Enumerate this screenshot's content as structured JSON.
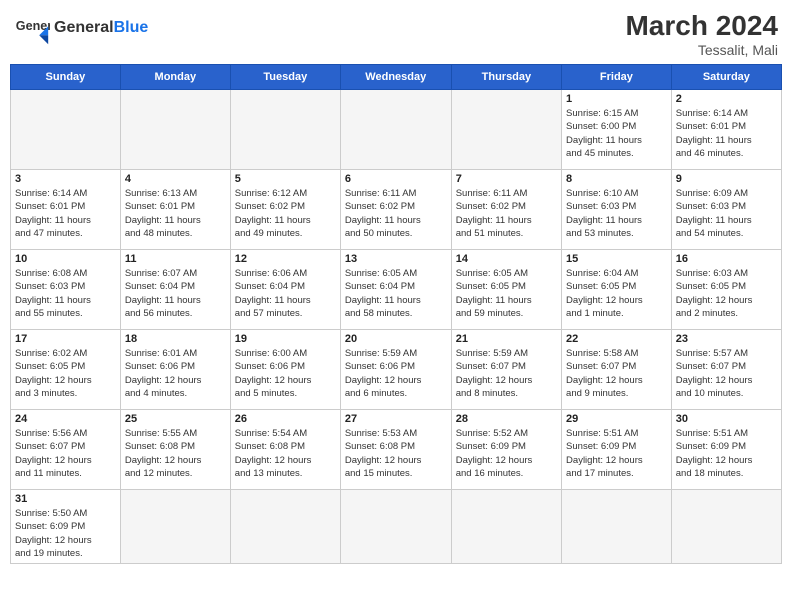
{
  "header": {
    "logo_general": "General",
    "logo_blue": "Blue",
    "month_year": "March 2024",
    "location": "Tessalit, Mali"
  },
  "weekdays": [
    "Sunday",
    "Monday",
    "Tuesday",
    "Wednesday",
    "Thursday",
    "Friday",
    "Saturday"
  ],
  "weeks": [
    [
      {
        "day": "",
        "info": ""
      },
      {
        "day": "",
        "info": ""
      },
      {
        "day": "",
        "info": ""
      },
      {
        "day": "",
        "info": ""
      },
      {
        "day": "",
        "info": ""
      },
      {
        "day": "1",
        "info": "Sunrise: 6:15 AM\nSunset: 6:00 PM\nDaylight: 11 hours\nand 45 minutes."
      },
      {
        "day": "2",
        "info": "Sunrise: 6:14 AM\nSunset: 6:01 PM\nDaylight: 11 hours\nand 46 minutes."
      }
    ],
    [
      {
        "day": "3",
        "info": "Sunrise: 6:14 AM\nSunset: 6:01 PM\nDaylight: 11 hours\nand 47 minutes."
      },
      {
        "day": "4",
        "info": "Sunrise: 6:13 AM\nSunset: 6:01 PM\nDaylight: 11 hours\nand 48 minutes."
      },
      {
        "day": "5",
        "info": "Sunrise: 6:12 AM\nSunset: 6:02 PM\nDaylight: 11 hours\nand 49 minutes."
      },
      {
        "day": "6",
        "info": "Sunrise: 6:11 AM\nSunset: 6:02 PM\nDaylight: 11 hours\nand 50 minutes."
      },
      {
        "day": "7",
        "info": "Sunrise: 6:11 AM\nSunset: 6:02 PM\nDaylight: 11 hours\nand 51 minutes."
      },
      {
        "day": "8",
        "info": "Sunrise: 6:10 AM\nSunset: 6:03 PM\nDaylight: 11 hours\nand 53 minutes."
      },
      {
        "day": "9",
        "info": "Sunrise: 6:09 AM\nSunset: 6:03 PM\nDaylight: 11 hours\nand 54 minutes."
      }
    ],
    [
      {
        "day": "10",
        "info": "Sunrise: 6:08 AM\nSunset: 6:03 PM\nDaylight: 11 hours\nand 55 minutes."
      },
      {
        "day": "11",
        "info": "Sunrise: 6:07 AM\nSunset: 6:04 PM\nDaylight: 11 hours\nand 56 minutes."
      },
      {
        "day": "12",
        "info": "Sunrise: 6:06 AM\nSunset: 6:04 PM\nDaylight: 11 hours\nand 57 minutes."
      },
      {
        "day": "13",
        "info": "Sunrise: 6:05 AM\nSunset: 6:04 PM\nDaylight: 11 hours\nand 58 minutes."
      },
      {
        "day": "14",
        "info": "Sunrise: 6:05 AM\nSunset: 6:05 PM\nDaylight: 11 hours\nand 59 minutes."
      },
      {
        "day": "15",
        "info": "Sunrise: 6:04 AM\nSunset: 6:05 PM\nDaylight: 12 hours\nand 1 minute."
      },
      {
        "day": "16",
        "info": "Sunrise: 6:03 AM\nSunset: 6:05 PM\nDaylight: 12 hours\nand 2 minutes."
      }
    ],
    [
      {
        "day": "17",
        "info": "Sunrise: 6:02 AM\nSunset: 6:05 PM\nDaylight: 12 hours\nand 3 minutes."
      },
      {
        "day": "18",
        "info": "Sunrise: 6:01 AM\nSunset: 6:06 PM\nDaylight: 12 hours\nand 4 minutes."
      },
      {
        "day": "19",
        "info": "Sunrise: 6:00 AM\nSunset: 6:06 PM\nDaylight: 12 hours\nand 5 minutes."
      },
      {
        "day": "20",
        "info": "Sunrise: 5:59 AM\nSunset: 6:06 PM\nDaylight: 12 hours\nand 6 minutes."
      },
      {
        "day": "21",
        "info": "Sunrise: 5:59 AM\nSunset: 6:07 PM\nDaylight: 12 hours\nand 8 minutes."
      },
      {
        "day": "22",
        "info": "Sunrise: 5:58 AM\nSunset: 6:07 PM\nDaylight: 12 hours\nand 9 minutes."
      },
      {
        "day": "23",
        "info": "Sunrise: 5:57 AM\nSunset: 6:07 PM\nDaylight: 12 hours\nand 10 minutes."
      }
    ],
    [
      {
        "day": "24",
        "info": "Sunrise: 5:56 AM\nSunset: 6:07 PM\nDaylight: 12 hours\nand 11 minutes."
      },
      {
        "day": "25",
        "info": "Sunrise: 5:55 AM\nSunset: 6:08 PM\nDaylight: 12 hours\nand 12 minutes."
      },
      {
        "day": "26",
        "info": "Sunrise: 5:54 AM\nSunset: 6:08 PM\nDaylight: 12 hours\nand 13 minutes."
      },
      {
        "day": "27",
        "info": "Sunrise: 5:53 AM\nSunset: 6:08 PM\nDaylight: 12 hours\nand 15 minutes."
      },
      {
        "day": "28",
        "info": "Sunrise: 5:52 AM\nSunset: 6:09 PM\nDaylight: 12 hours\nand 16 minutes."
      },
      {
        "day": "29",
        "info": "Sunrise: 5:51 AM\nSunset: 6:09 PM\nDaylight: 12 hours\nand 17 minutes."
      },
      {
        "day": "30",
        "info": "Sunrise: 5:51 AM\nSunset: 6:09 PM\nDaylight: 12 hours\nand 18 minutes."
      }
    ],
    [
      {
        "day": "31",
        "info": "Sunrise: 5:50 AM\nSunset: 6:09 PM\nDaylight: 12 hours\nand 19 minutes."
      },
      {
        "day": "",
        "info": ""
      },
      {
        "day": "",
        "info": ""
      },
      {
        "day": "",
        "info": ""
      },
      {
        "day": "",
        "info": ""
      },
      {
        "day": "",
        "info": ""
      },
      {
        "day": "",
        "info": ""
      }
    ]
  ]
}
